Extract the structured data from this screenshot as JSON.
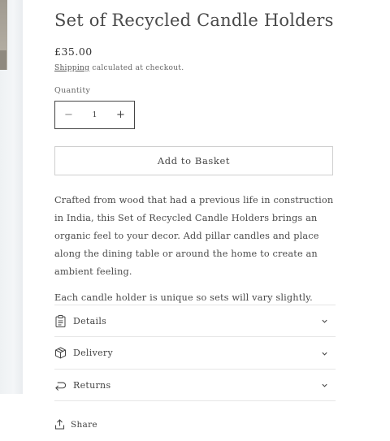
{
  "product": {
    "title": "Set of Recycled Candle Holders",
    "price": "£35.00",
    "shipping_link": "Shipping",
    "shipping_text": " calculated at checkout."
  },
  "quantity": {
    "label": "Quantity",
    "value": "1",
    "minus": "−",
    "plus": "+"
  },
  "add_to_basket": "Add to Basket",
  "description": {
    "paragraph_1": "Crafted from wood that had a previous life in construction in India, this Set of Recycled Candle Holders brings an organic feel to your decor. Add pillar candles and place along the dining table or around the home to create an ambient feeling.",
    "paragraph_2": "Each candle holder is unique so sets will vary slightly."
  },
  "accordion": [
    {
      "label": "Details",
      "icon": "clipboard-icon"
    },
    {
      "label": "Delivery",
      "icon": "box-icon"
    },
    {
      "label": "Returns",
      "icon": "return-arrow-icon"
    }
  ],
  "share": {
    "label": "Share",
    "icon": "share-icon"
  }
}
